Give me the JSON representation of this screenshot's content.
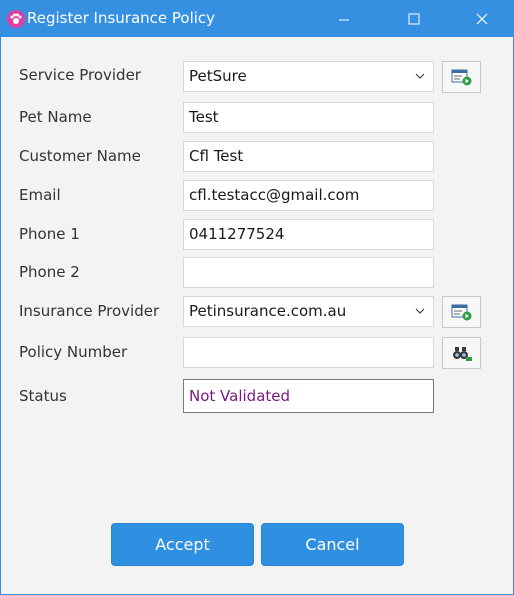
{
  "window": {
    "title": "Register Insurance Policy",
    "icon": "paw-icon",
    "controls": {
      "minimize": "—",
      "maximize": "☐",
      "close": "✕"
    }
  },
  "form": {
    "service_provider": {
      "label": "Service Provider",
      "value": "PetSure"
    },
    "pet_name": {
      "label": "Pet Name",
      "value": "Test"
    },
    "customer_name": {
      "label": "Customer Name",
      "value": "Cfl Test"
    },
    "email": {
      "label": "Email",
      "value": "cfl.testacc@gmail.com"
    },
    "phone1": {
      "label": "Phone 1",
      "value": "0411277524"
    },
    "phone2": {
      "label": "Phone 2",
      "value": ""
    },
    "insurance_provider": {
      "label": "Insurance Provider",
      "value": "Petinsurance.com.au"
    },
    "policy_number": {
      "label": "Policy Number",
      "value": ""
    },
    "status": {
      "label": "Status",
      "value": "Not Validated"
    }
  },
  "buttons": {
    "accept": "Accept",
    "cancel": "Cancel"
  },
  "colors": {
    "titlebar": "#3590e2",
    "primary_button": "#2f8fe0",
    "status_text": "#7a1a80",
    "app_icon": "#e03ea4"
  }
}
